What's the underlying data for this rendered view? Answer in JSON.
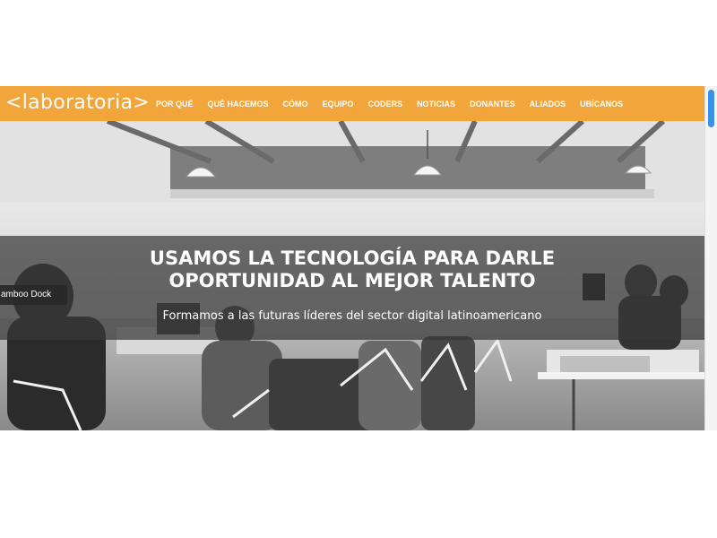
{
  "brand": {
    "logo_text": "<laboratoria>"
  },
  "nav": {
    "items": [
      "POR QUÉ",
      "QUÉ HACEMOS",
      "CÓMO",
      "EQUIPO",
      "CODERS",
      "NOTICIAS",
      "DONANTES",
      "ALIADOS",
      "UBÍCANOS"
    ]
  },
  "hero": {
    "headline_line1": "USAMOS LA TECNOLOGÍA PARA DARLE",
    "headline_line2": "OPORTUNIDAD AL MEJOR TALENTO",
    "subheadline": "Formamos a las futuras líderes del sector digital latinoamericano"
  },
  "tooltip": {
    "text": "amboo Dock"
  },
  "colors": {
    "accent": "#f2a53a",
    "scroll_thumb": "#3a8fe6"
  }
}
